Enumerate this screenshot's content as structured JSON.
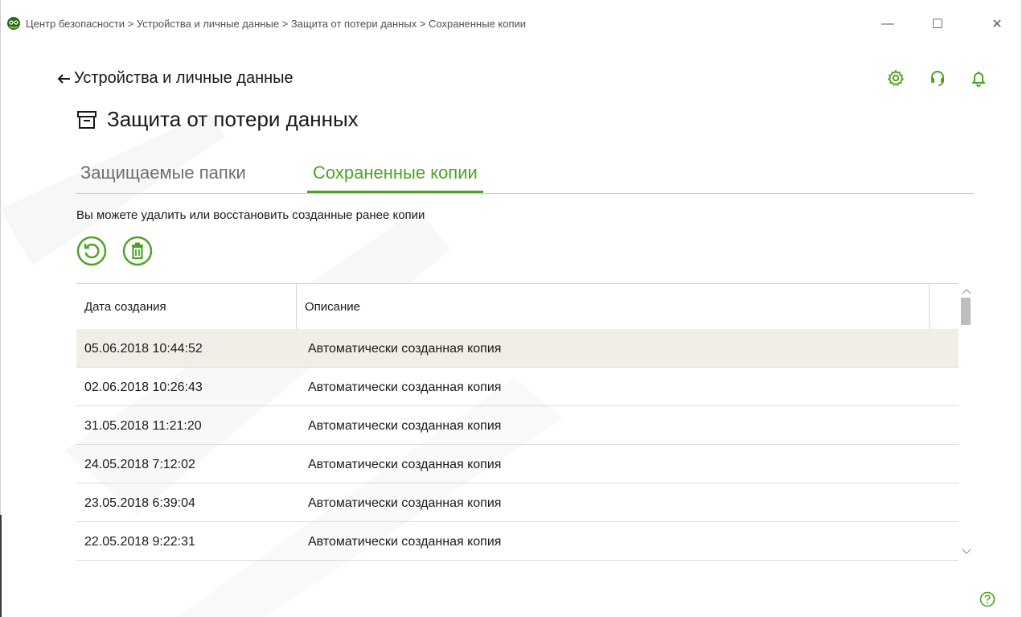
{
  "window": {
    "title": "Центр безопасности > Устройства и личные данные > Защита от потери данных > Сохраненные копии",
    "minimize_glyph": "—",
    "maximize_glyph": "☐",
    "close_glyph": "✕"
  },
  "header": {
    "back_label": "Устройства и личные данные",
    "icons": [
      "gear-icon",
      "support-headset-icon",
      "bell-icon"
    ]
  },
  "page": {
    "title": "Защита от потери данных",
    "title_icon": "archive-box-icon"
  },
  "tabs": [
    {
      "label": "Защищаемые папки",
      "active": false
    },
    {
      "label": "Сохраненные копии",
      "active": true
    }
  ],
  "hint": "Вы можете удалить или восстановить созданные ранее копии",
  "toolbar": {
    "restore_icon": "restore-icon",
    "delete_icon": "trash-icon"
  },
  "table": {
    "columns": [
      "Дата создания",
      "Описание"
    ],
    "rows": [
      {
        "date": "05.06.2018 10:44:52",
        "description": "Автоматически созданная копия",
        "selected": true
      },
      {
        "date": "02.06.2018 10:26:43",
        "description": "Автоматически созданная копия",
        "selected": false
      },
      {
        "date": "31.05.2018 11:21:20",
        "description": "Автоматически созданная копия",
        "selected": false
      },
      {
        "date": "24.05.2018 7:12:02",
        "description": "Автоматически созданная копия",
        "selected": false
      },
      {
        "date": "23.05.2018 6:39:04",
        "description": "Автоматически созданная копия",
        "selected": false
      },
      {
        "date": "22.05.2018 9:22:31",
        "description": "Автоматически созданная копия",
        "selected": false
      }
    ]
  },
  "colors": {
    "accent": "#4da324",
    "selected_row": "#f0eee6",
    "text": "#1a1a1a",
    "muted": "#6e6e6e"
  }
}
